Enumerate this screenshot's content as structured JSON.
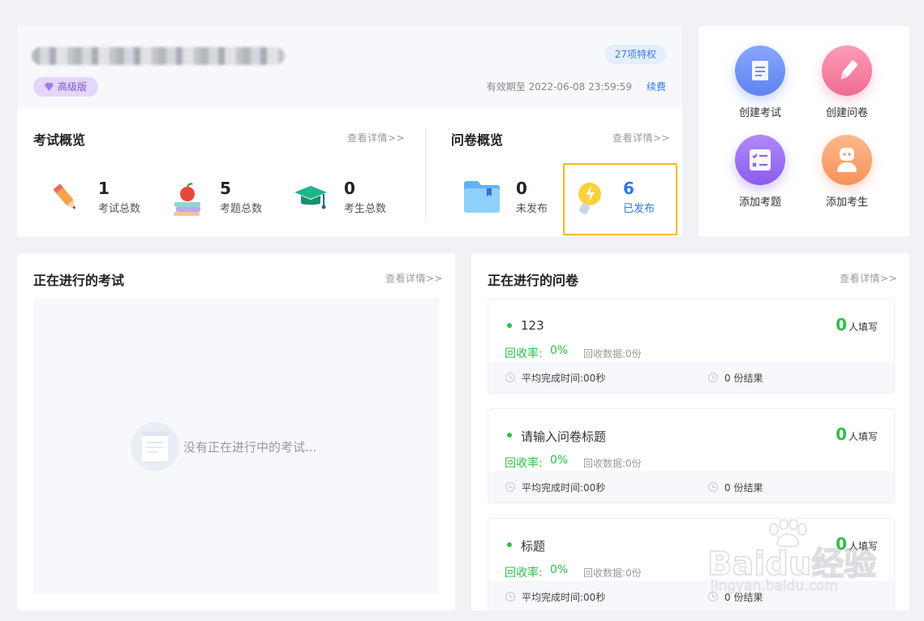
{
  "account": {
    "edition_badge": "高级版",
    "privileges_badge": "27项特权",
    "expiry": "有效期至 2022-06-08 23:59:59",
    "renew_link": "续费"
  },
  "exam_overview": {
    "title": "考试概览",
    "detail_link": "查看详情>>",
    "stats": [
      {
        "value": "1",
        "label": "考试总数",
        "icon": "pencil-icon"
      },
      {
        "value": "5",
        "label": "考题总数",
        "icon": "books-apple-icon"
      },
      {
        "value": "0",
        "label": "考生总数",
        "icon": "graduation-cap-icon"
      }
    ]
  },
  "survey_overview": {
    "title": "问卷概览",
    "detail_link": "查看详情>>",
    "stats": [
      {
        "value": "0",
        "label": "未发布",
        "icon": "folder-icon"
      },
      {
        "value": "6",
        "label": "已发布",
        "icon": "lightbulb-icon"
      }
    ]
  },
  "quick_actions": [
    {
      "label": "创建考试",
      "icon": "document-icon",
      "color": "#6b8ef7"
    },
    {
      "label": "创建问卷",
      "icon": "pencil-icon",
      "color": "#f47fa0"
    },
    {
      "label": "添加考题",
      "icon": "checklist-icon",
      "color": "#9b6cf3"
    },
    {
      "label": "添加考生",
      "icon": "user-icon",
      "color": "#f9a672"
    }
  ],
  "ongoing_exams": {
    "title": "正在进行的考试",
    "detail_link": "查看详情>>",
    "empty_text": "没有正在进行中的考试..."
  },
  "ongoing_surveys": {
    "title": "正在进行的问卷",
    "detail_link": "查看详情>>",
    "items": [
      {
        "name": "123",
        "fill_count": "0",
        "fill_label": "人填写",
        "rate_label": "回收率:",
        "rate_value": "0%",
        "data_label": "回收数据:0份",
        "avg_time": "平均完成时间:00秒",
        "results": "0 份结果"
      },
      {
        "name": "请输入问卷标题",
        "fill_count": "0",
        "fill_label": "人填写",
        "rate_label": "回收率:",
        "rate_value": "0%",
        "data_label": "回收数据:0份",
        "avg_time": "平均完成时间:00秒",
        "results": "0 份结果"
      },
      {
        "name": "标题",
        "fill_count": "0",
        "fill_label": "人填写",
        "rate_label": "回收率:",
        "rate_value": "0%",
        "data_label": "回收数据:0份",
        "avg_time": "平均完成时间:00秒",
        "results": "0 份结果"
      }
    ]
  },
  "watermark": {
    "main": "Baidu经验",
    "sub": "jingyan.baidu.com"
  },
  "colors": {
    "accent_blue": "#2f76e8",
    "success_green": "#2fbf4c",
    "highlight_yellow": "#f2b91d",
    "premium_purple": "#7e55d8"
  }
}
